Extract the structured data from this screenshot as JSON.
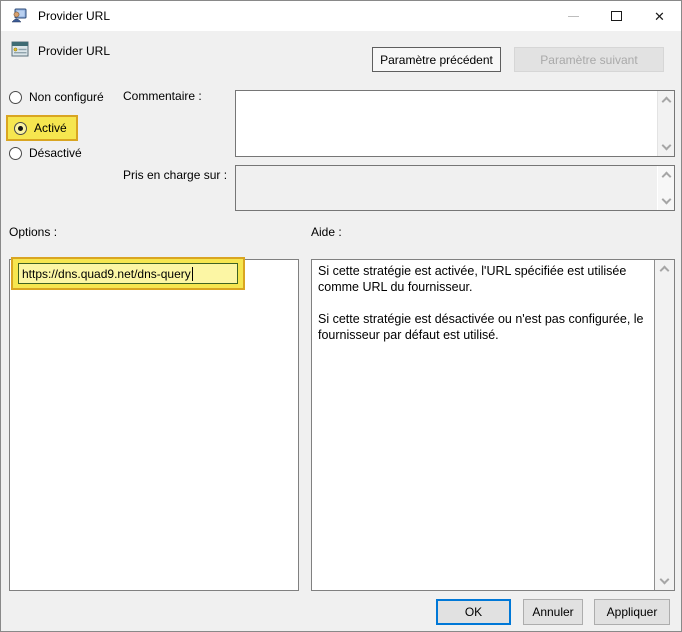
{
  "window": {
    "title": "Provider URL"
  },
  "header": {
    "setting_title": "Provider URL",
    "previous_button": "Paramètre précédent",
    "next_button": "Paramètre suivant"
  },
  "state": {
    "not_configured": "Non configuré",
    "enabled": "Activé",
    "disabled": "Désactivé",
    "selected_value": "Activé"
  },
  "labels": {
    "comment": "Commentaire :",
    "supported_on": "Pris en charge sur :",
    "options": "Options :",
    "help": "Aide :"
  },
  "fields": {
    "comment_value": "",
    "supported_on_value": "",
    "provider_url_value": "https://dns.quad9.net/dns-query"
  },
  "help": {
    "paragraph1": "Si cette stratégie est activée, l'URL spécifiée est utilisée comme URL du fournisseur.",
    "paragraph2": "Si cette stratégie est désactivée ou n'est pas configurée, le fournisseur par défaut est utilisé."
  },
  "footer": {
    "ok": "OK",
    "cancel": "Annuler",
    "apply": "Appliquer"
  },
  "colors": {
    "highlight_fill": "#F6E64F",
    "highlight_border": "#D9A521",
    "focus_blue": "#0078D7",
    "dialog_background": "#F0F0F0"
  }
}
